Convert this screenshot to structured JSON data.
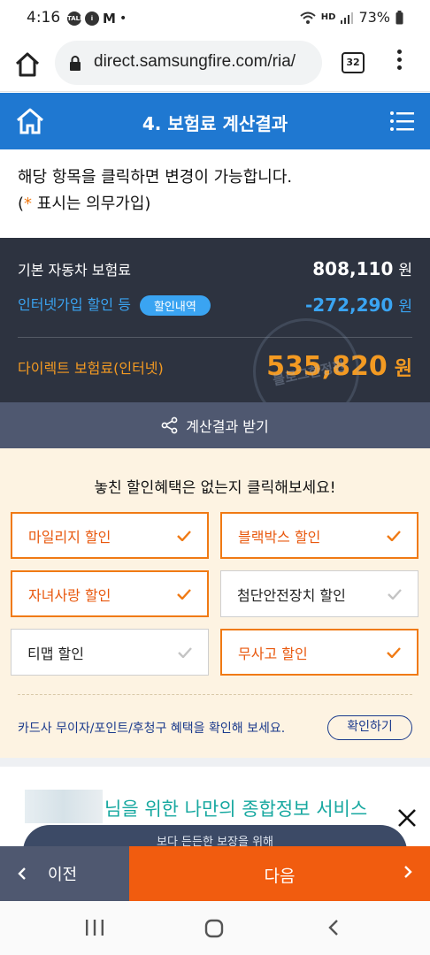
{
  "status": {
    "time": "4:16",
    "battery": "73%",
    "hd": "HD"
  },
  "browser": {
    "url": "direct.samsungfire.com/ria/",
    "tab_count": "32"
  },
  "header": {
    "title": "4. 보험료 계산결과"
  },
  "notice": {
    "line1": "해당 항목을 클릭하면 변경이 가능합니다.",
    "line2_prefix": "(",
    "line2_star": "*",
    "line2_suffix": " 표시는 의무가입)"
  },
  "summary": {
    "base_label": "기본 자동차 보험료",
    "base_value": "808,110",
    "unit": "원",
    "discount_label": "인터넷가입 할인 등",
    "discount_pill": "할인내역",
    "discount_value": "-272,290",
    "direct_label": "다이렉트 보험료(인터넷)",
    "direct_value": "535,820"
  },
  "share": {
    "label": "계산결과 받기"
  },
  "discounts": {
    "title": "놓친 할인혜택은 없는지 클릭해보세요!",
    "items": [
      {
        "label": "마일리지 할인",
        "selected": true
      },
      {
        "label": "블랙박스 할인",
        "selected": true
      },
      {
        "label": "자녀사랑 할인",
        "selected": true
      },
      {
        "label": "첨단안전장치 할인",
        "selected": false
      },
      {
        "label": "티맵 할인",
        "selected": false
      },
      {
        "label": "무사고 할인",
        "selected": true
      }
    ],
    "card_text": "카드사 무이자/포인트/후청구 혜택을 확인해 보세요.",
    "card_button": "확인하기"
  },
  "promo": {
    "title": "님을 위한 나만의 종합정보 서비스",
    "subtitle": "보다 든든한 보장을 위해"
  },
  "watermark": {
    "text": "블로그한정판"
  },
  "nav": {
    "prev": "이전",
    "next": "다음"
  },
  "colors": {
    "header": "#1f78d1",
    "accent": "#f07a14",
    "next": "#f15c0f",
    "dark": "#2d3340"
  }
}
